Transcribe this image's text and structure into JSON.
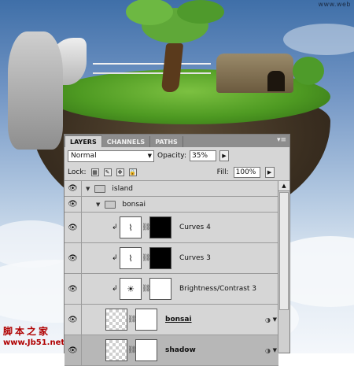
{
  "watermark": "www.web",
  "site_cn": "脚本之家",
  "site_url": "www.Jb51.net",
  "panel": {
    "tabs": [
      "LAYERS",
      "CHANNELS",
      "PATHS"
    ],
    "menu_icon": "panel-menu-icon",
    "blend_mode": "Normal",
    "opacity_label": "Opacity:",
    "opacity_value": "35%",
    "lock_label": "Lock:",
    "fill_label": "Fill:",
    "fill_value": "100%"
  },
  "layers": [
    {
      "name": "island",
      "type": "group"
    },
    {
      "name": "bonsai",
      "type": "group"
    },
    {
      "name": "Curves 4",
      "type": "adjustment"
    },
    {
      "name": "Curves 3",
      "type": "adjustment"
    },
    {
      "name": "Brightness/Contrast 3",
      "type": "adjustment"
    },
    {
      "name": "bonsai",
      "type": "pixel"
    },
    {
      "name": "shadow",
      "type": "pixel",
      "selected": true
    }
  ]
}
